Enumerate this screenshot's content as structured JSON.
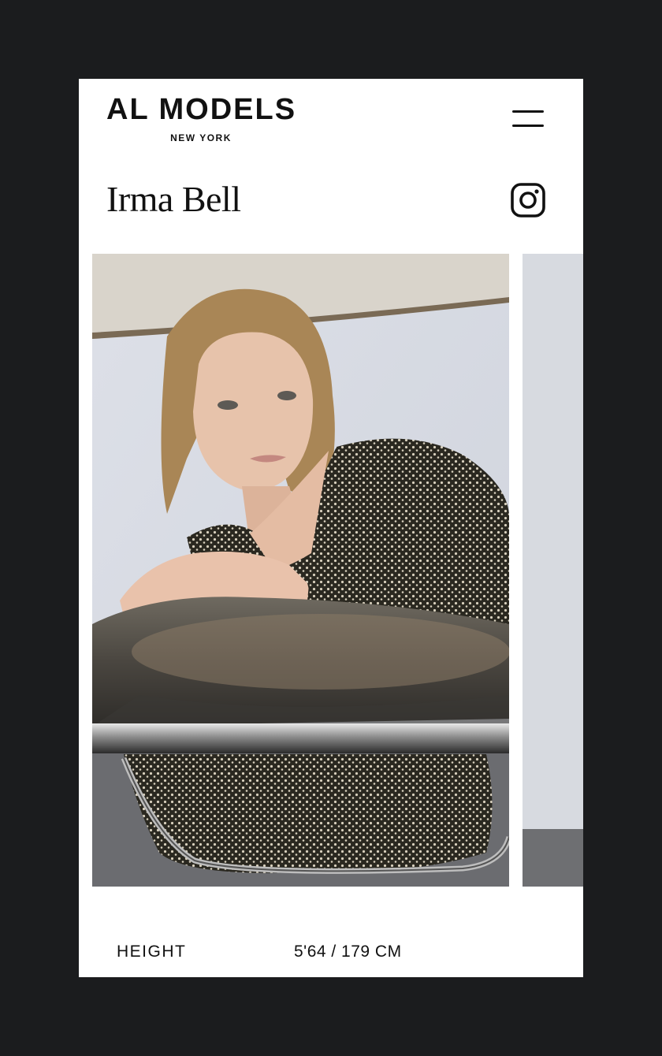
{
  "header": {
    "brand_name": "AL MODELS",
    "brand_city": "NEW YORK",
    "menu_icon": "hamburger-menu-icon"
  },
  "profile": {
    "name": "Irma Bell",
    "social_icon": "instagram-icon"
  },
  "gallery": {
    "photos": [
      "portrait-photo",
      "next-photo-preview"
    ]
  },
  "stats": [
    {
      "label": "HEIGHT",
      "value": "5'64 / 179 CM"
    }
  ],
  "colors": {
    "background": "#1b1c1e",
    "card": "#ffffff",
    "text": "#111111"
  }
}
